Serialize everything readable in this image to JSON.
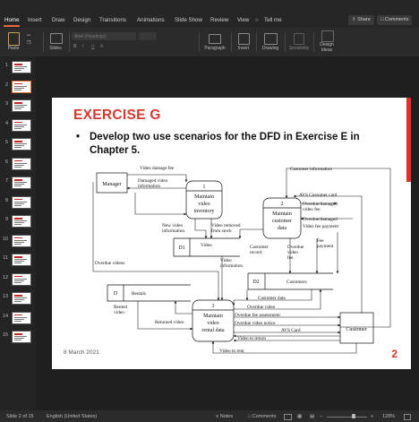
{
  "ribbon_tabs": [
    "Home",
    "Insert",
    "Draw",
    "Design",
    "Transitions",
    "Animations",
    "Slide Show",
    "Review",
    "View"
  ],
  "tell_me": "Tell me",
  "share": "Share",
  "comments": "Comments",
  "ribbon": {
    "paste": "Paste",
    "slides": "Slides",
    "font_name": "Arial (Headings)",
    "paragraph": "Paragraph",
    "insert": "Insert",
    "drawing": "Drawing",
    "sensitivity": "Sensitivity",
    "design_ideas": "Design Ideas"
  },
  "thumbnail_numbers": [
    "1",
    "2",
    "3",
    "4",
    "5",
    "6",
    "7",
    "8",
    "9",
    "10",
    "11",
    "12",
    "13",
    "14",
    "15"
  ],
  "slide": {
    "title": "EXERCISE G",
    "bullet": "Develop two use scenarios for the DFD in Exercise E in Chapter 5.",
    "date": "8 March 2021",
    "page_number": "2"
  },
  "dfd": {
    "manager": "Manager",
    "customer": "Customer",
    "p1": {
      "num": "1",
      "l1": "Maintain",
      "l2": "video",
      "l3": "inventory"
    },
    "p2": {
      "num": "2",
      "l1": "Maintain",
      "l2": "customer",
      "l3": "data"
    },
    "p3": {
      "num": "3",
      "l1": "Maintain",
      "l2": "video",
      "l3": "rental data"
    },
    "d1": {
      "id": "D1",
      "name": "Video"
    },
    "d2": {
      "id": "D2",
      "name": "Customers"
    },
    "d": {
      "id": "D",
      "name": "Rentals"
    },
    "flows": {
      "video_damage_fee": "Video damage fee",
      "damaged_video_1": "Damaged video",
      "damaged_video_2": "information",
      "customer_information": "Customer information",
      "avs_customer_card": "AVS Customer card",
      "overdue_damaged_fee_1": "Overdue/damaged",
      "overdue_damaged_fee_2": "video fee",
      "overdue_damaged_payment": "Overdue/damaged",
      "video_fee_payment": "Video fee payment",
      "fee_payment_1": "Fee",
      "fee_payment_2": "payment",
      "new_video_1": "New video",
      "new_video_2": "information",
      "video_removed_1": "Video removed",
      "video_removed_2": "from stock",
      "customer_record_1": "Customer",
      "customer_record_2": "record",
      "overdue_video_fee_1": "Overdue",
      "overdue_video_fee_2": "video",
      "overdue_video_fee_3": "fee",
      "overdue_videos": "Overdue videos",
      "video_information_1": "Video",
      "video_information_2": "information",
      "rented_video_1": "Rented",
      "rented_video_2": "video",
      "returned_video": "Returned video",
      "customer_data": "Customer data",
      "overdue_video": "Overdue video",
      "overdue_fee_assessment": "Overdue fee assessment",
      "overdue_video_notice": "Overdue video notice",
      "avs_card": "AVS Card",
      "video_to_return": "Video to return",
      "video_to_rent": "Video to rent"
    }
  },
  "status": {
    "slide_counter": "Slide 2 of 15",
    "language": "English (United States)",
    "notes": "Notes",
    "comments": "Comments",
    "zoom": "128%"
  },
  "colors": {
    "accent": "#e46c3c",
    "title_red": "#d43a2f",
    "page_red": "#e0302a"
  }
}
